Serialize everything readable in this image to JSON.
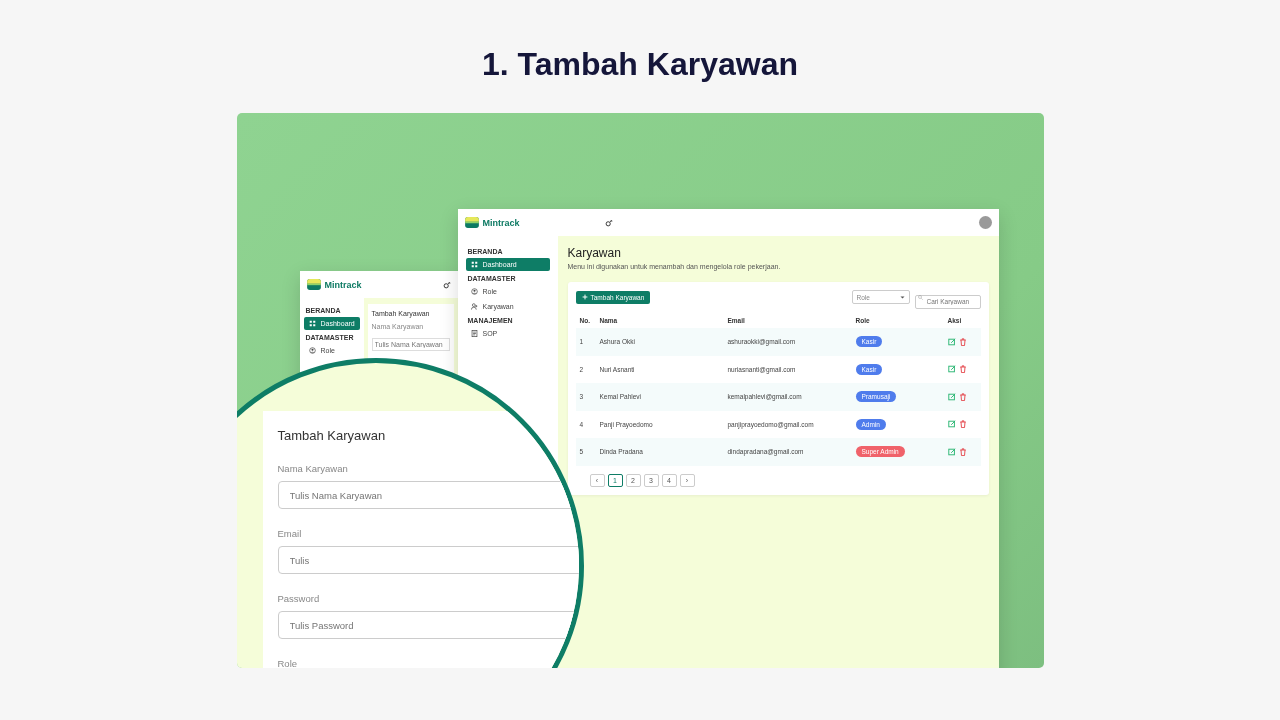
{
  "heading": "1. Tambah Karyawan",
  "back_screen": {
    "brand": "Mintrack",
    "sidebar": [
      {
        "title": "BERANDA",
        "items": [
          {
            "label": "Dashboard",
            "kind": "grid",
            "selected": true
          }
        ]
      },
      {
        "title": "DATAMASTER",
        "items": [
          {
            "label": "Role",
            "kind": "role",
            "selected": false
          }
        ]
      }
    ],
    "form_title": "Tambah Karyawan",
    "field_label": "Nama Karyawan",
    "field_placeholder": "Tulis Nama Karyawan"
  },
  "main_screen": {
    "brand": "Mintrack",
    "sidebar": [
      {
        "title": "BERANDA",
        "items": [
          {
            "label": "Dashboard",
            "kind": "grid",
            "selected": true
          }
        ]
      },
      {
        "title": "DATAMASTER",
        "items": [
          {
            "label": "Role",
            "kind": "role",
            "selected": false
          },
          {
            "label": "Karyawan",
            "kind": "person-add",
            "selected": false
          }
        ]
      },
      {
        "title": "MANAJEMEN",
        "items": [
          {
            "label": "SOP",
            "kind": "doc",
            "selected": false
          }
        ]
      }
    ],
    "page_title": "Karyawan",
    "description": "Menu ini digunakan untuk menambah dan mengelola role pekerjaan.",
    "add_button": "Tambah Karyawan",
    "role_filter": "Role",
    "search_placeholder": "Cari Karyawan",
    "columns": [
      "No.",
      "Nama",
      "Email",
      "Role",
      "Aksi"
    ],
    "rows": [
      {
        "no": "1",
        "name": "Ashura Okki",
        "email": "ashuraokki@gmail.com",
        "role": "Kasir",
        "color": "#4f7cec"
      },
      {
        "no": "2",
        "name": "Nuri Asnanti",
        "email": "nuriasnanti@gmail.com",
        "role": "Kasir",
        "color": "#4f7cec"
      },
      {
        "no": "3",
        "name": "Kemal Pahlevi",
        "email": "kemalpahlevi@gmail.com",
        "role": "Pramusaji",
        "color": "#4f7cec"
      },
      {
        "no": "4",
        "name": "Panji Prayoedomo",
        "email": "panjiprayoedomo@gmail.com",
        "role": "Admin",
        "color": "#4f7cec"
      },
      {
        "no": "5",
        "name": "Dinda Pradana",
        "email": "dindapradana@gmail.com",
        "role": "Super Admin",
        "color": "#f0626a"
      }
    ],
    "pagination": [
      {
        "label": "‹",
        "selected": false
      },
      {
        "label": "1",
        "selected": true
      },
      {
        "label": "2",
        "selected": false
      },
      {
        "label": "3",
        "selected": false
      },
      {
        "label": "4",
        "selected": false
      },
      {
        "label": "›",
        "selected": false
      }
    ]
  },
  "magnifier": {
    "form_title": "Tambah Karyawan",
    "fields": [
      {
        "label": "Nama Karyawan",
        "placeholder": "Tulis Nama Karyawan"
      },
      {
        "label": "Email",
        "placeholder": "Tulis"
      },
      {
        "label": "Password",
        "placeholder": "Tulis Password"
      },
      {
        "label": "Role"
      }
    ]
  }
}
